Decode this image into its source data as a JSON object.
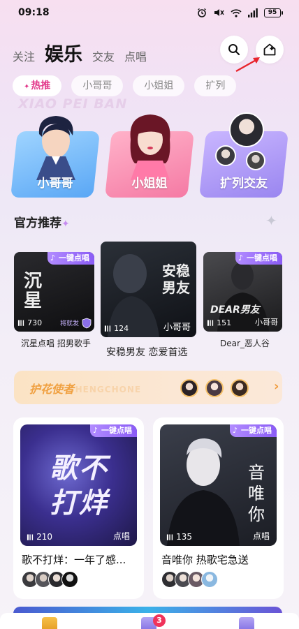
{
  "status_bar": {
    "time": "09:18",
    "battery": "95"
  },
  "header": {
    "tabs": [
      {
        "label": "关注"
      },
      {
        "label": "娱乐"
      },
      {
        "label": "交友"
      },
      {
        "label": "点唱"
      }
    ],
    "active_tab": "娱乐"
  },
  "sub_tabs": [
    {
      "label": "热推"
    },
    {
      "label": "小哥哥"
    },
    {
      "label": "小姐姐"
    },
    {
      "label": "扩列"
    }
  ],
  "watermark": "XIAO PEI BAN",
  "categories": [
    {
      "label": "小哥哥",
      "color": "#5aa7f5"
    },
    {
      "label": "小姐姐",
      "color": "#f57aa4"
    },
    {
      "label": "扩列交友",
      "color": "#9a86f0"
    }
  ],
  "official": {
    "title": "官方推荐",
    "items": [
      {
        "name": "沉星点唱 招男歌手",
        "count": "730",
        "badge": "一键点唱",
        "art_text": "沉星",
        "tag": "将就发"
      },
      {
        "name": "安稳男友 恋爱首选",
        "count": "124",
        "art_text": "安稳男友",
        "tag": "小哥哥"
      },
      {
        "name": "Dear_恶人谷",
        "count": "151",
        "badge": "一键点唱",
        "art_text": "DEAR男友",
        "tag": "小哥哥"
      }
    ]
  },
  "guardian": {
    "title": "护花使者",
    "ghost": "SHENGCHONE"
  },
  "rooms": [
    {
      "title": "歌不打烊：一年了感...",
      "count": "210",
      "tag": "点唱",
      "badge": "一键点唱",
      "art_text": "歌不打烊"
    },
    {
      "title": "音唯你 热歌宅急送",
      "count": "135",
      "tag": "点唱",
      "badge": "一键点唱",
      "art_text": "音唯你"
    }
  ],
  "tab_bar": {
    "badge": "3"
  },
  "colors": {
    "accent": "#e2388a",
    "guardian": "#f0a040",
    "badge": "#f0335b"
  }
}
